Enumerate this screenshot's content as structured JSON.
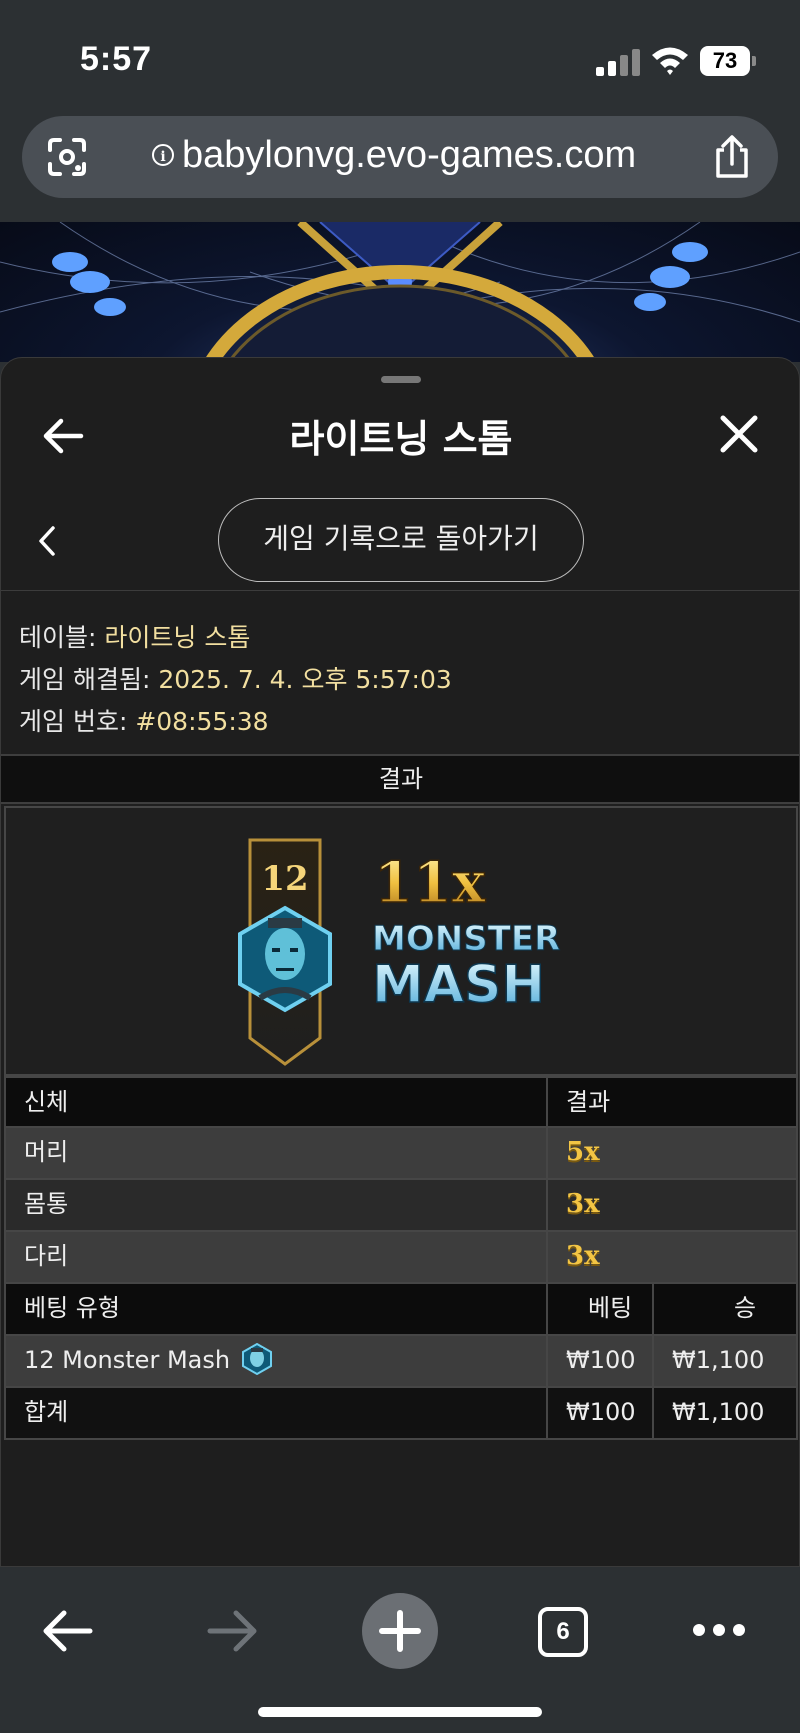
{
  "status_bar": {
    "time": "5:57",
    "battery": "73"
  },
  "browser": {
    "url": "babylonvg.evo-games.com"
  },
  "sheet": {
    "title": "라이트닝 스톰",
    "back_to_history": "게임 기록으로 돌아가기",
    "table_label": "테이블:",
    "table_value": "라이트닝 스톰",
    "resolved_label": "게임 해결됨:",
    "resolved_value": "2025. 7. 4. 오후 5:57:03",
    "game_no_label": "게임 번호:",
    "game_no_value": "#08:55:38",
    "result_heading": "결과"
  },
  "result_graphic": {
    "number": "12",
    "multiplier": "11x",
    "name_line1": "MONSTER",
    "name_line2": "MASH"
  },
  "body_table": {
    "headers": [
      "신체",
      "결과"
    ],
    "rows": [
      {
        "part": "머리",
        "mult": "5x"
      },
      {
        "part": "몸통",
        "mult": "3x"
      },
      {
        "part": "다리",
        "mult": "3x"
      }
    ]
  },
  "bet_table": {
    "headers": [
      "베팅 유형",
      "베팅",
      "승"
    ],
    "rows": [
      {
        "type": "12 Monster Mash",
        "bet": "₩100",
        "win": "₩1,100"
      }
    ],
    "total": {
      "label": "합계",
      "bet": "₩100",
      "win": "₩1,100"
    }
  },
  "toolbar": {
    "tab_count": "6"
  },
  "colors": {
    "accent_gold": "#f3c544",
    "meta_value": "#f2dfa0",
    "sheet_bg": "#1e1e1e"
  }
}
